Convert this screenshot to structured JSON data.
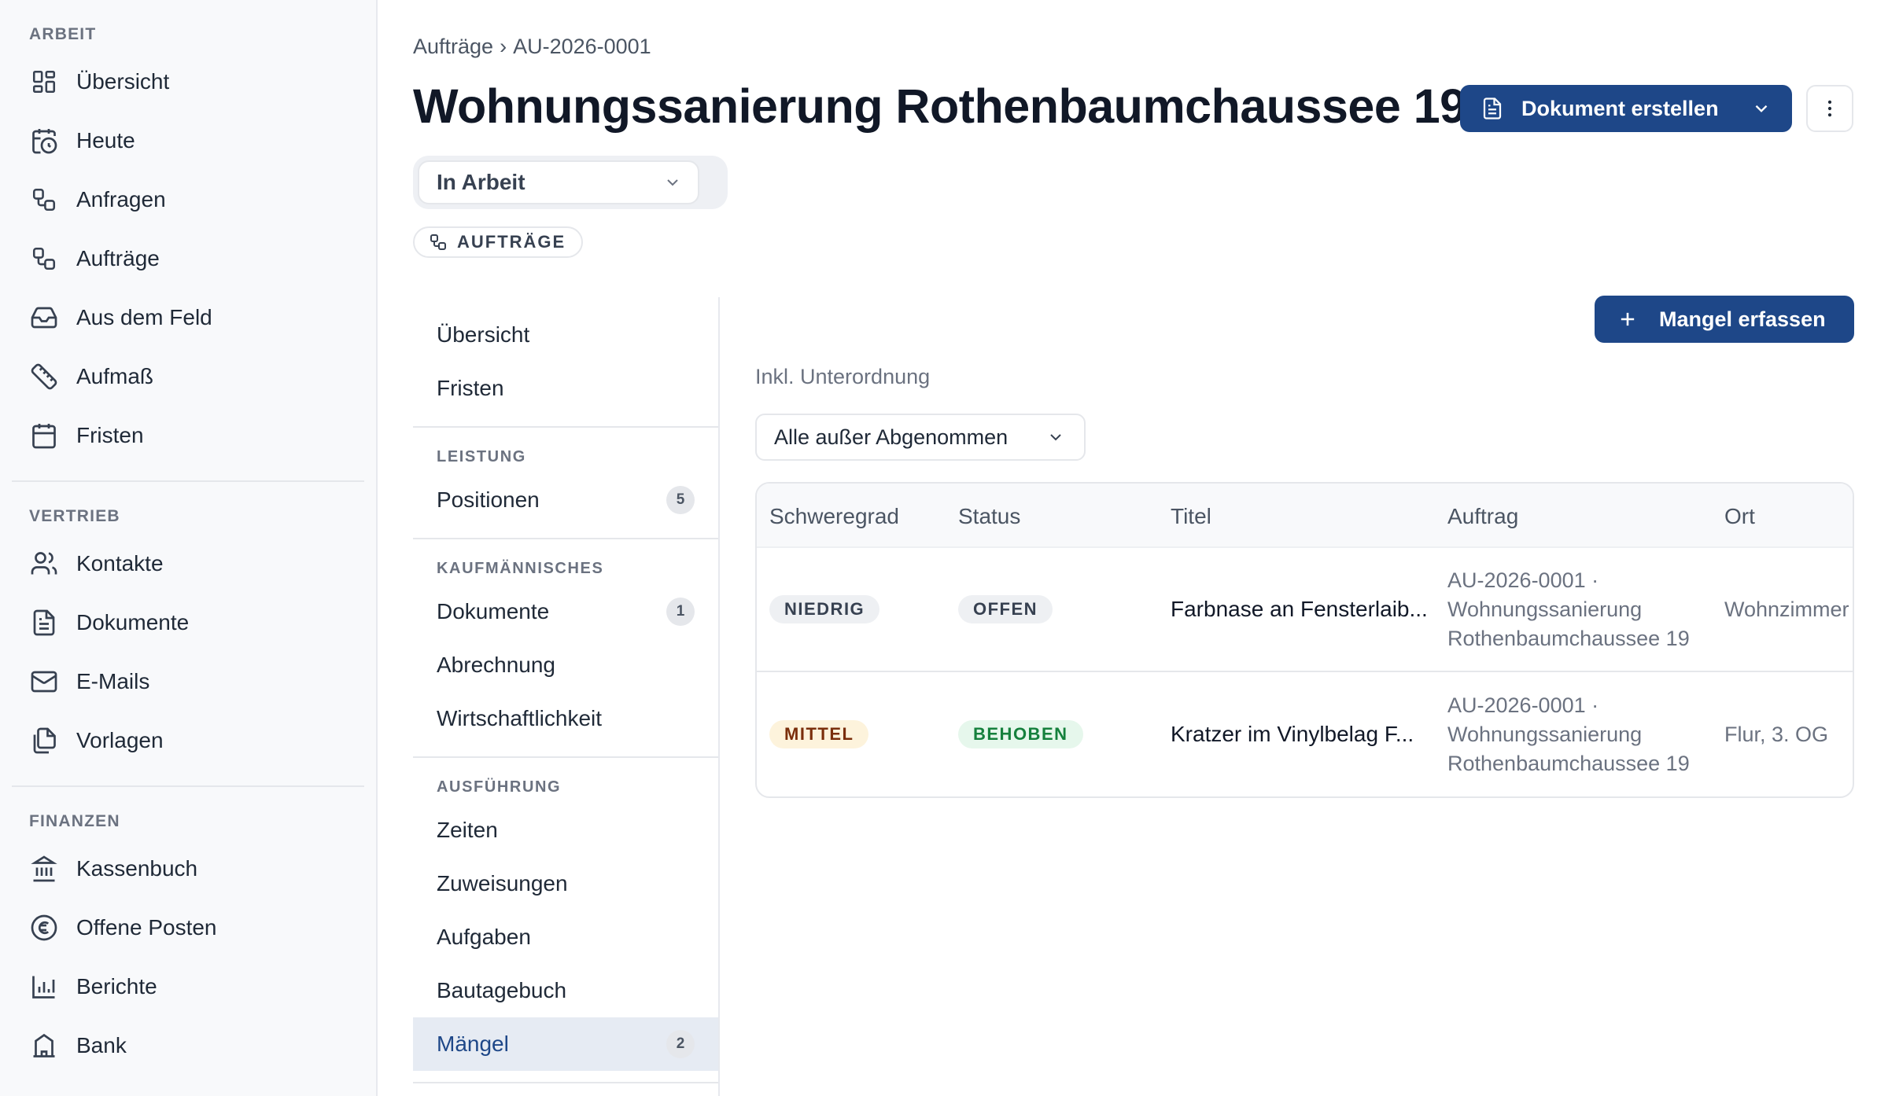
{
  "sidebar": {
    "sections": [
      {
        "title": "ARBEIT",
        "items": [
          {
            "label": "Übersicht",
            "icon": "dashboard-icon"
          },
          {
            "label": "Heute",
            "icon": "calendar-clock-icon"
          },
          {
            "label": "Anfragen",
            "icon": "workflow-icon"
          },
          {
            "label": "Aufträge",
            "icon": "workflow-icon"
          },
          {
            "label": "Aus dem Feld",
            "icon": "inbox-icon"
          },
          {
            "label": "Aufmaß",
            "icon": "ruler-icon"
          },
          {
            "label": "Fristen",
            "icon": "calendar-icon"
          }
        ]
      },
      {
        "title": "VERTRIEB",
        "items": [
          {
            "label": "Kontakte",
            "icon": "users-icon"
          },
          {
            "label": "Dokumente",
            "icon": "document-icon"
          },
          {
            "label": "E-Mails",
            "icon": "mail-icon"
          },
          {
            "label": "Vorlagen",
            "icon": "copy-icon"
          }
        ]
      },
      {
        "title": "FINANZEN",
        "items": [
          {
            "label": "Kassenbuch",
            "icon": "bank-icon"
          },
          {
            "label": "Offene Posten",
            "icon": "euro-icon"
          },
          {
            "label": "Berichte",
            "icon": "bar-chart-icon"
          },
          {
            "label": "Bank",
            "icon": "building-icon"
          }
        ]
      }
    ]
  },
  "header": {
    "breadcrumb": {
      "parent": "Aufträge",
      "separator": "›",
      "current": "AU-2026-0001"
    },
    "title": "Wohnungssanierung Rothenbaumchaussee 19",
    "primary_button": "Dokument erstellen",
    "status_value": "In Arbeit",
    "chip": "AUFTRÄGE"
  },
  "subnav": {
    "top": [
      "Übersicht",
      "Fristen"
    ],
    "leistung": {
      "title": "LEISTUNG",
      "items": [
        {
          "label": "Positionen",
          "badge": "5"
        }
      ]
    },
    "kaufm": {
      "title": "KAUFMÄNNISCHES",
      "items": [
        {
          "label": "Dokumente",
          "badge": "1"
        },
        {
          "label": "Abrechnung"
        },
        {
          "label": "Wirtschaftlichkeit"
        }
      ]
    },
    "ausf": {
      "title": "AUSFÜHRUNG",
      "items": [
        {
          "label": "Zeiten"
        },
        {
          "label": "Zuweisungen"
        },
        {
          "label": "Aufgaben"
        },
        {
          "label": "Bautagebuch"
        },
        {
          "label": "Mängel",
          "badge": "2"
        }
      ]
    }
  },
  "content": {
    "add_button": "Mangel erfassen",
    "filter_label": "Inkl. Unterordnung",
    "filter_value": "Alle außer Abgenommen",
    "table": {
      "headers": [
        "Schweregrad",
        "Status",
        "Titel",
        "Auftrag",
        "Ort"
      ],
      "rows": [
        {
          "severity": "NIEDRIG",
          "status": "OFFEN",
          "title": "Farbnase an Fensterlaib...",
          "order_line1": "AU-2026-0001 ·",
          "order_line2": "Wohnungssanierung",
          "order_line3": "Rothenbaumchaussee 19",
          "location": "Wohnzimmer"
        },
        {
          "severity": "MITTEL",
          "status": "BEHOBEN",
          "title": "Kratzer im Vinylbelag F...",
          "order_line1": "AU-2026-0001 ·",
          "order_line2": "Wohnungssanierung",
          "order_line3": "Rothenbaumchaussee 19",
          "location": "Flur, 3. OG"
        }
      ]
    }
  },
  "colors": {
    "brand": "#1e4788",
    "severity_low_bg": "#eef0f3",
    "severity_medium_bg": "#fdf3dc",
    "status_fixed_fg": "#15803d"
  }
}
